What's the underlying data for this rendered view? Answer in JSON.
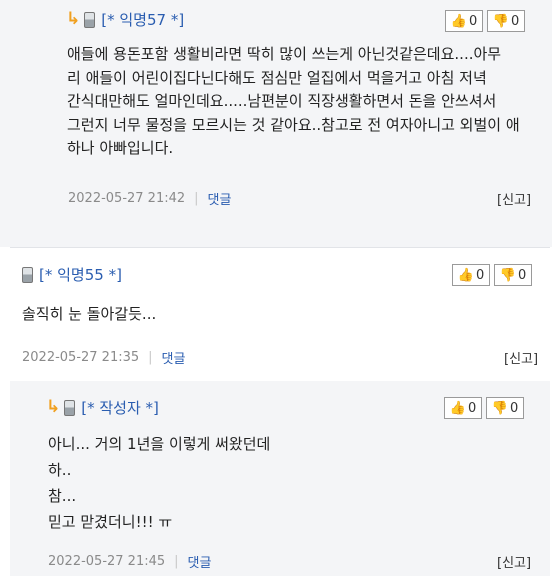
{
  "comments": [
    {
      "author": "[* 익명57 *]",
      "likes": "0",
      "dislikes": "0",
      "lines": [
        "애들에 용돈포함 생활비라면 딱히 많이 쓰는게 아닌것같은데요....아무",
        "리 애들이 어린이집다닌다해도 점심만 얼집에서 먹을거고 아침 저녁",
        "간식대만해도 얼마인데요.....남편분이 직장생활하면서 돈을 안쓰셔서",
        "그런지 너무 물정을 모르시는 것 같아요..참고로 전 여자아니고 외벌이 애",
        "하나 아빠입니다."
      ],
      "date": "2022-05-27 21:42",
      "reply_label": "댓글",
      "report_label": "[신고]"
    },
    {
      "author": "[* 익명55 *]",
      "likes": "0",
      "dislikes": "0",
      "lines": [
        "솔직히 눈 돌아갈듯..."
      ],
      "date": "2022-05-27 21:35",
      "reply_label": "댓글",
      "report_label": "[신고]"
    },
    {
      "author": "[* 작성자 *]",
      "likes": "0",
      "dislikes": "0",
      "lines": [
        "아니... 거의 1년을 이렇게 써왔던데",
        "하..",
        "참...",
        "믿고 맏겼더니!!! ㅠ"
      ],
      "date": "2022-05-27 21:45",
      "reply_label": "댓글",
      "report_label": "[신고]"
    }
  ]
}
